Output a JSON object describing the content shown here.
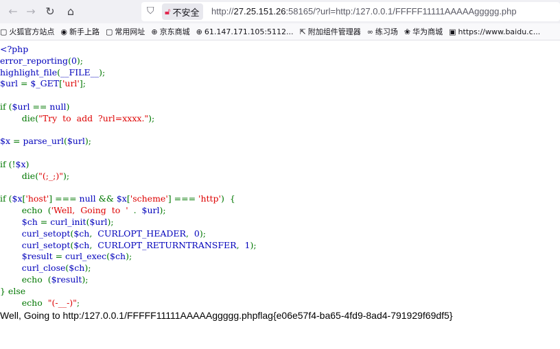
{
  "nav": {
    "back_icon": "←",
    "forward_icon": "→",
    "reload_icon": "↻",
    "home_icon": "⌂"
  },
  "urlbar": {
    "shield_icon": "⛉",
    "security_label": "不安全",
    "url_prefix": "http://",
    "url_host": "27.25.151.26",
    "url_rest": ":58165/?url=http:/127.0.0.1/FFFFF11111AAAAAggggg.php"
  },
  "bookmarks": [
    {
      "icon": "▢",
      "label": "火狐官方站点"
    },
    {
      "icon": "◉",
      "label": "新手上路"
    },
    {
      "icon": "▢",
      "label": "常用网址"
    },
    {
      "icon": "⊕",
      "label": "京东商城"
    },
    {
      "icon": "⊕",
      "label": "61.147.171.105:5112..."
    },
    {
      "icon": "⇱",
      "label": "附加组件管理器"
    },
    {
      "icon": "∞",
      "label": "练习场"
    },
    {
      "icon": "❀",
      "label": "华为商城"
    },
    {
      "icon": "▣",
      "label": "https://www.baidu.c..."
    }
  ],
  "code_lines": [
    [
      {
        "t": "<?php",
        "c": "df"
      }
    ],
    [
      {
        "t": "error_reporting",
        "c": "df"
      },
      {
        "t": "(",
        "c": "kw"
      },
      {
        "t": "0",
        "c": "df"
      },
      {
        "t": ");",
        "c": "kw"
      }
    ],
    [
      {
        "t": "highlight_file",
        "c": "df"
      },
      {
        "t": "(",
        "c": "kw"
      },
      {
        "t": "__FILE__",
        "c": "df"
      },
      {
        "t": ");",
        "c": "kw"
      }
    ],
    [
      {
        "t": "$url ",
        "c": "df"
      },
      {
        "t": "= ",
        "c": "kw"
      },
      {
        "t": "$_GET",
        "c": "df"
      },
      {
        "t": "[",
        "c": "kw"
      },
      {
        "t": "'url'",
        "c": "st"
      },
      {
        "t": "];",
        "c": "kw"
      }
    ],
    [],
    [
      {
        "t": "if ",
        "c": "kw"
      },
      {
        "t": "(",
        "c": "kw"
      },
      {
        "t": "$url ",
        "c": "df"
      },
      {
        "t": "== ",
        "c": "kw"
      },
      {
        "t": "null",
        "c": "df"
      },
      {
        "t": ")",
        "c": "kw"
      }
    ],
    [
      {
        "t": "        die",
        "c": "kw"
      },
      {
        "t": "(",
        "c": "kw"
      },
      {
        "t": "\"Try  to  add  ?url=xxxx.\"",
        "c": "st"
      },
      {
        "t": ");",
        "c": "kw"
      }
    ],
    [],
    [
      {
        "t": "$x ",
        "c": "df"
      },
      {
        "t": "= ",
        "c": "kw"
      },
      {
        "t": "parse_url",
        "c": "df"
      },
      {
        "t": "(",
        "c": "kw"
      },
      {
        "t": "$url",
        "c": "df"
      },
      {
        "t": ");",
        "c": "kw"
      }
    ],
    [],
    [
      {
        "t": "if ",
        "c": "kw"
      },
      {
        "t": "(!",
        "c": "kw"
      },
      {
        "t": "$x",
        "c": "df"
      },
      {
        "t": ")",
        "c": "kw"
      }
    ],
    [
      {
        "t": "        die",
        "c": "kw"
      },
      {
        "t": "(",
        "c": "kw"
      },
      {
        "t": "\"(;_;)\"",
        "c": "st"
      },
      {
        "t": ");",
        "c": "kw"
      }
    ],
    [],
    [
      {
        "t": "if ",
        "c": "kw"
      },
      {
        "t": "(",
        "c": "kw"
      },
      {
        "t": "$x",
        "c": "df"
      },
      {
        "t": "[",
        "c": "kw"
      },
      {
        "t": "'host'",
        "c": "st"
      },
      {
        "t": "] === ",
        "c": "kw"
      },
      {
        "t": "null ",
        "c": "df"
      },
      {
        "t": "&& ",
        "c": "kw"
      },
      {
        "t": "$x",
        "c": "df"
      },
      {
        "t": "[",
        "c": "kw"
      },
      {
        "t": "'scheme'",
        "c": "st"
      },
      {
        "t": "] === ",
        "c": "kw"
      },
      {
        "t": "'http'",
        "c": "st"
      },
      {
        "t": ")  {",
        "c": "kw"
      }
    ],
    [
      {
        "t": "        echo  ",
        "c": "kw"
      },
      {
        "t": "(",
        "c": "kw"
      },
      {
        "t": "'Well,  Going  to  '",
        "c": "st"
      },
      {
        "t": "  .  ",
        "c": "kw"
      },
      {
        "t": "$url",
        "c": "df"
      },
      {
        "t": ");",
        "c": "kw"
      }
    ],
    [
      {
        "t": "        $ch ",
        "c": "df"
      },
      {
        "t": "= ",
        "c": "kw"
      },
      {
        "t": "curl_init",
        "c": "df"
      },
      {
        "t": "(",
        "c": "kw"
      },
      {
        "t": "$url",
        "c": "df"
      },
      {
        "t": ");",
        "c": "kw"
      }
    ],
    [
      {
        "t": "        curl_setopt",
        "c": "df"
      },
      {
        "t": "(",
        "c": "kw"
      },
      {
        "t": "$ch",
        "c": "df"
      },
      {
        "t": ",  ",
        "c": "kw"
      },
      {
        "t": "CURLOPT_HEADER",
        "c": "df"
      },
      {
        "t": ",  ",
        "c": "kw"
      },
      {
        "t": "0",
        "c": "df"
      },
      {
        "t": ");",
        "c": "kw"
      }
    ],
    [
      {
        "t": "        curl_setopt",
        "c": "df"
      },
      {
        "t": "(",
        "c": "kw"
      },
      {
        "t": "$ch",
        "c": "df"
      },
      {
        "t": ",  ",
        "c": "kw"
      },
      {
        "t": "CURLOPT_RETURNTRANSFER",
        "c": "df"
      },
      {
        "t": ",  ",
        "c": "kw"
      },
      {
        "t": "1",
        "c": "df"
      },
      {
        "t": ");",
        "c": "kw"
      }
    ],
    [
      {
        "t": "        $result ",
        "c": "df"
      },
      {
        "t": "= ",
        "c": "kw"
      },
      {
        "t": "curl_exec",
        "c": "df"
      },
      {
        "t": "(",
        "c": "kw"
      },
      {
        "t": "$ch",
        "c": "df"
      },
      {
        "t": ");",
        "c": "kw"
      }
    ],
    [
      {
        "t": "        curl_close",
        "c": "df"
      },
      {
        "t": "(",
        "c": "kw"
      },
      {
        "t": "$ch",
        "c": "df"
      },
      {
        "t": ");",
        "c": "kw"
      }
    ],
    [
      {
        "t": "        echo  ",
        "c": "kw"
      },
      {
        "t": "(",
        "c": "kw"
      },
      {
        "t": "$result",
        "c": "df"
      },
      {
        "t": ");",
        "c": "kw"
      }
    ],
    [
      {
        "t": "} else",
        "c": "kw"
      }
    ],
    [
      {
        "t": "        echo  ",
        "c": "kw"
      },
      {
        "t": "\"(-__-)\"",
        "c": "st"
      },
      {
        "t": ";",
        "c": "kw"
      }
    ]
  ],
  "output_text": "Well, Going to http:/127.0.0.1/FFFFF11111AAAAAggggg.phpflag{e06e57f4-ba65-4fd9-8ad4-791929f69df5}"
}
